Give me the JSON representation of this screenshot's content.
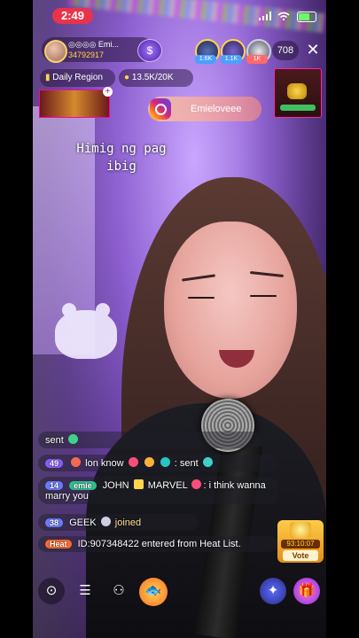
{
  "status": {
    "time": "2:49"
  },
  "host": {
    "name": "◎◎◎◎ Emi...",
    "score": "34792917",
    "badge_icon": "dollar-badge-icon"
  },
  "viewers": {
    "count": "708",
    "tags": [
      "1.6K",
      "1.1K",
      "1K"
    ]
  },
  "region": {
    "label": "Daily Region"
  },
  "goal": {
    "label": "13.5K/20K"
  },
  "instagram": {
    "handle": "Emieloveee"
  },
  "lyrics": {
    "line1": "Himig ng pag",
    "line2": "ibig"
  },
  "chat": [
    {
      "level": "",
      "user": "",
      "text": "sent"
    },
    {
      "level": "49",
      "user": "lon know",
      "text": "sent"
    },
    {
      "level": "14",
      "user": "JOHN",
      "text": "MARVEL",
      "message": "i think wanna marry you"
    },
    {
      "level": "38",
      "user": "GEEK",
      "text": "joined"
    },
    {
      "level": "Heat",
      "user": "ID:907348422",
      "text": "entered from Heat List."
    }
  ],
  "vote": {
    "timer": "93:10:07",
    "label": "Vote"
  },
  "colors": {
    "accent": "#e8334a",
    "gold": "#ffd54a",
    "purple": "#8d5fd0"
  }
}
